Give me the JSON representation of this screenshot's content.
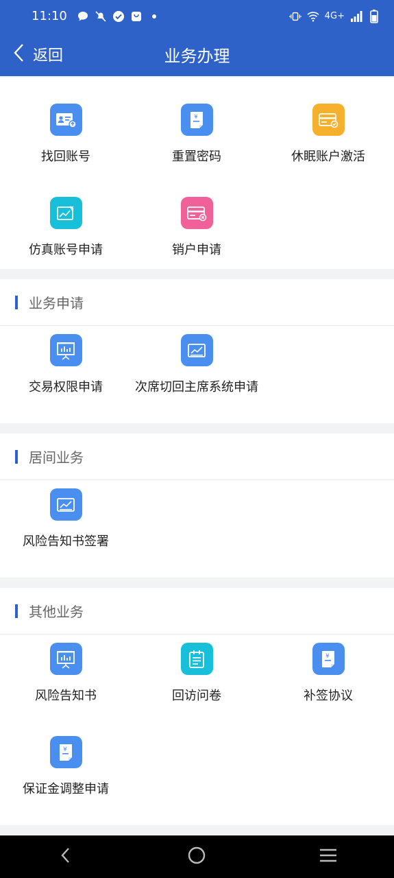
{
  "status": {
    "time": "11:10",
    "network": "4G+"
  },
  "header": {
    "back_label": "返回",
    "title": "业务办理"
  },
  "section0": {
    "items": [
      {
        "label": "找回账号",
        "color": "#4a8ef0",
        "icon": "id-card-icon"
      },
      {
        "label": "重置密码",
        "color": "#4a8ef0",
        "icon": "document-yuan-icon"
      },
      {
        "label": "休眠账户激活",
        "color": "#f7b02b",
        "icon": "card-check-icon"
      },
      {
        "label": "仿真账号申请",
        "color": "#17bfd9",
        "icon": "chart-yuan-icon"
      },
      {
        "label": "销户申请",
        "color": "#f0619a",
        "icon": "card-cancel-icon"
      }
    ]
  },
  "section1": {
    "title": "业务申请",
    "items": [
      {
        "label": "交易权限申请",
        "color": "#4a8ef0",
        "icon": "presentation-icon"
      },
      {
        "label": "次席切回主席系统申请",
        "color": "#4a8ef0",
        "icon": "trend-chart-icon"
      }
    ]
  },
  "section2": {
    "title": "居间业务",
    "items": [
      {
        "label": "风险告知书签署",
        "color": "#4a8ef0",
        "icon": "trend-chart-icon"
      }
    ]
  },
  "section3": {
    "title": "其他业务",
    "items": [
      {
        "label": "风险告知书",
        "color": "#4a8ef0",
        "icon": "presentation-icon"
      },
      {
        "label": "回访问卷",
        "color": "#17bfd9",
        "icon": "clipboard-icon"
      },
      {
        "label": "补签协议",
        "color": "#4a8ef0",
        "icon": "document-yuan-icon"
      },
      {
        "label": "保证金调整申请",
        "color": "#4a8ef0",
        "icon": "document-yuan-icon"
      }
    ]
  }
}
